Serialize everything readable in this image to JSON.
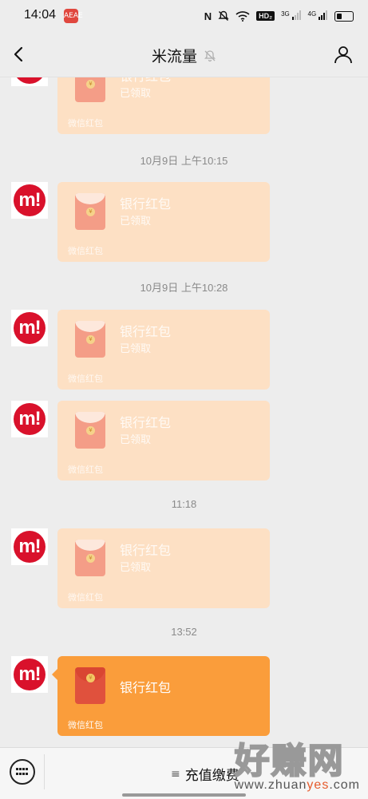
{
  "status_bar": {
    "time": "14:04",
    "app_icon_text": "AEAE",
    "nfc": "N",
    "hd": "HD₂",
    "net1": "3G",
    "net2": "4G"
  },
  "header": {
    "title": "米流量"
  },
  "avatar_text": "m!",
  "messages": [
    {
      "title": "银行红包",
      "status": "已领取",
      "footer": "微信红包"
    },
    {
      "title": "银行红包",
      "status": "已领取",
      "footer": "微信红包"
    },
    {
      "title": "银行红包",
      "status": "已领取",
      "footer": "微信红包"
    },
    {
      "title": "银行红包",
      "status": "已领取",
      "footer": "微信红包"
    },
    {
      "title": "银行红包",
      "status": "已领取",
      "footer": "微信红包"
    },
    {
      "title": "银行红包",
      "status": "",
      "footer": "微信红包"
    }
  ],
  "timestamps": [
    "10月9日 上午10:15",
    "10月9日 上午10:28",
    "11:18",
    "13:52"
  ],
  "input_bar": {
    "menu_label": "充值缴费"
  },
  "watermark": {
    "main": "好赚网",
    "url_pre": "www.zhuan",
    "url_mid": "yes",
    "url_post": ".com"
  },
  "colors": {
    "received_bubble": "#fde0c4",
    "active_bubble": "#fa9d3b",
    "avatar_brand": "#d9112b"
  }
}
